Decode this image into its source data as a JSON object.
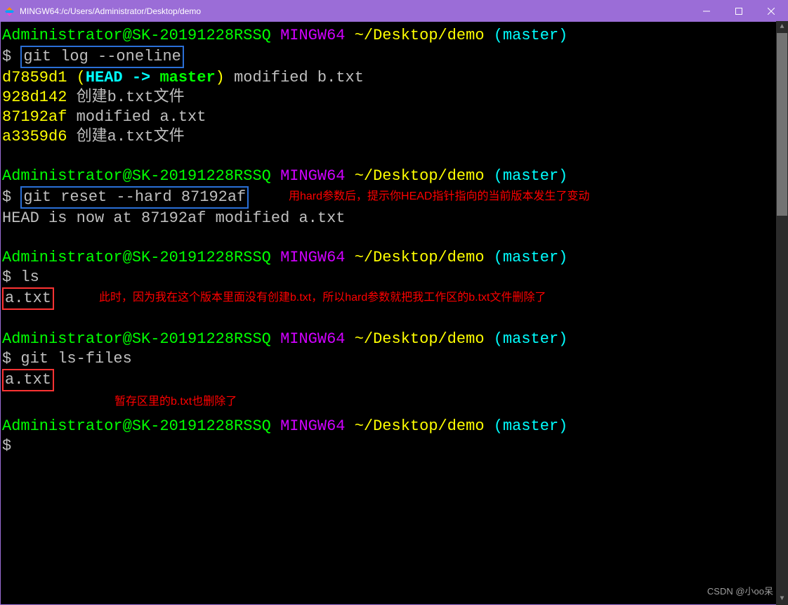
{
  "window": {
    "title": "MINGW64:/c/Users/Administrator/Desktop/demo"
  },
  "prompt": {
    "userhost": "Administrator@SK-20191228RSSQ",
    "shell": "MINGW64",
    "cwd": "~/Desktop/demo",
    "branch": "(master)",
    "ps": "$"
  },
  "cmd": {
    "c1": "git log --oneline",
    "c2": "git reset --hard 87192af",
    "c3": "ls",
    "c4": "git ls-files"
  },
  "log": {
    "hash1": "d7859d1",
    "lp": "(",
    "head": "HEAD -> ",
    "master": "master",
    "rp": ")",
    "msg1": " modified b.txt",
    "l2_hash": "928d142",
    "l2_msg": " 创建b.txt文件",
    "l3_hash": "87192af",
    "l3_msg": " modified a.txt",
    "l4_hash": "a3359d6",
    "l4_msg": " 创建a.txt文件"
  },
  "out": {
    "reset_line": "HEAD is now at 87192af modified a.txt",
    "atxt1": "a.txt",
    "atxt2": "a.txt"
  },
  "annot": {
    "a1": "用hard参数后，提示你HEAD指针指向的当前版本发生了变动",
    "a2": "此时，因为我在这个版本里面没有创建b.txt，所以hard参数就把我工作区的b.txt文件删除了",
    "a3": "暂存区里的b.txt也删除了"
  },
  "watermark": "CSDN @小oo呆"
}
